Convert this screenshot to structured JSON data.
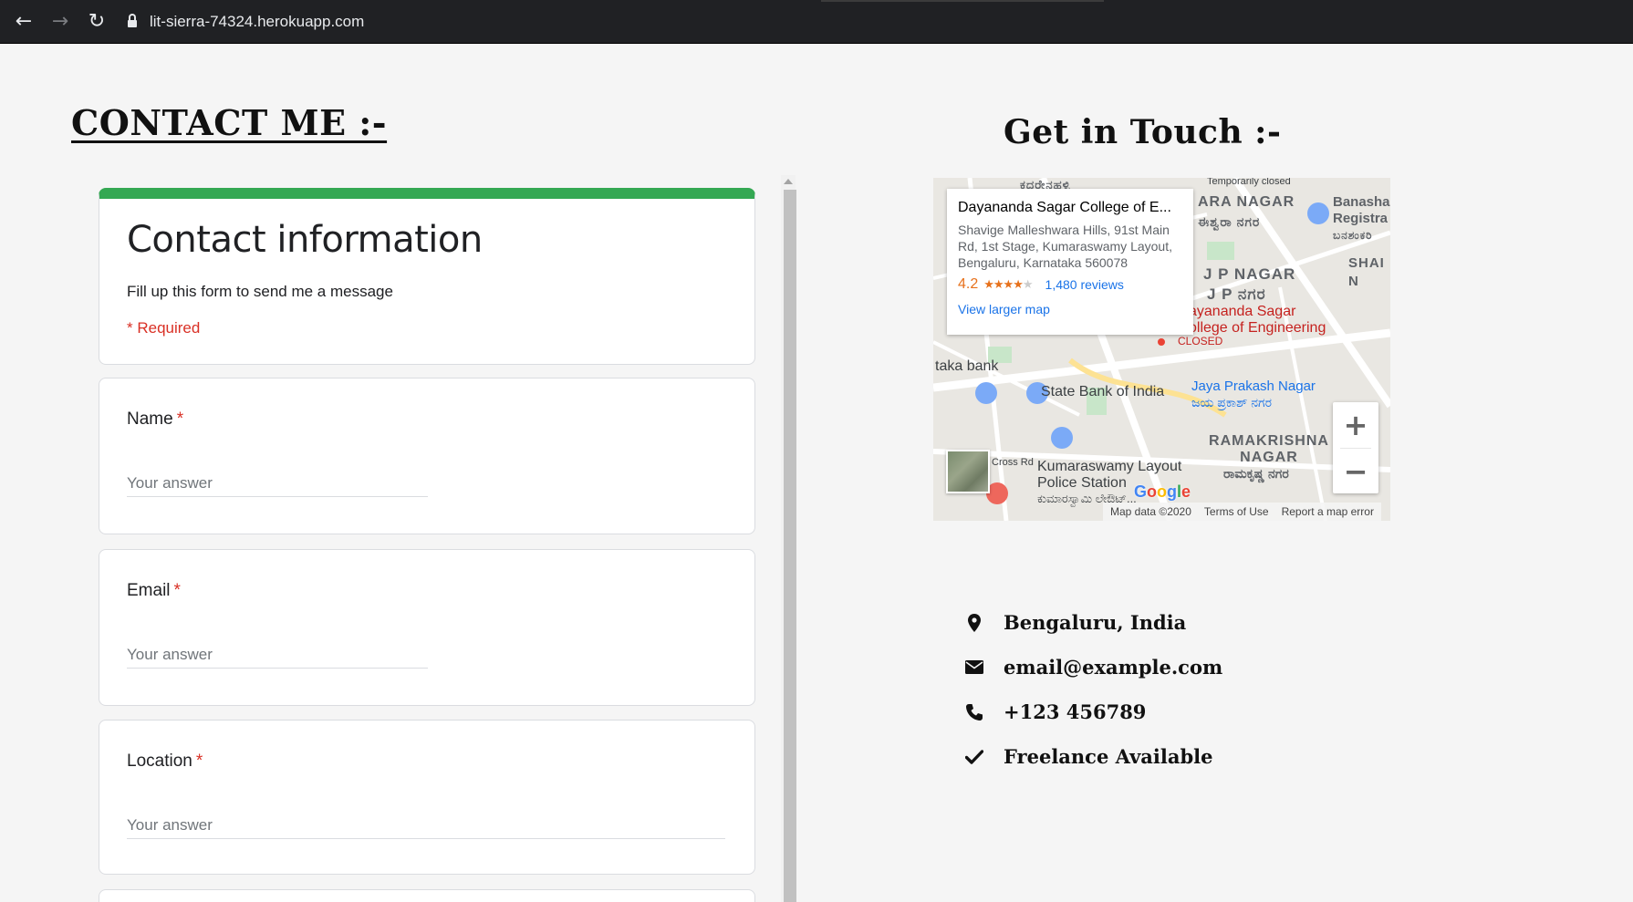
{
  "browser": {
    "url": "lit-sierra-74324.herokuapp.com",
    "back_icon": "arrow-left-icon",
    "forward_icon": "arrow-right-icon",
    "reload_icon": "reload-icon"
  },
  "page": {
    "contact_heading": "CONTACT ME :-",
    "touch_heading": "Get in Touch :-"
  },
  "form": {
    "title": "Contact information",
    "description": "Fill up this form to send me a message",
    "required_note": "* Required",
    "accent_color": "#34a853",
    "questions": [
      {
        "label": "Name",
        "placeholder": "Your answer"
      },
      {
        "label": "Email",
        "placeholder": "Your answer"
      },
      {
        "label": "Location",
        "placeholder": "Your answer"
      }
    ],
    "required_star": "*"
  },
  "map": {
    "place_name": "Dayananda Sagar College of E...",
    "address": "Shavige Malleshwara Hills, 91st Main Rd, 1st Stage, Kumaraswamy Layout, Bengaluru, Karnataka 560078",
    "rating": "4.2",
    "stars_filled": 4,
    "reviews": "1,480 reviews",
    "larger_map": "View larger map",
    "zoom_in": "+",
    "zoom_out": "−",
    "footer": {
      "map_data": "Map data ©2020",
      "terms": "Terms of Use",
      "report": "Report a map error"
    },
    "labels": {
      "top": "ಕದರೇನಹಳ್ಳಿ",
      "temp_closed": "Temporarily closed",
      "ara_nagar": "ARA NAGAR",
      "ara_nagar_kn": "ಈಶ್ವರಾ ನಗರ",
      "banashankari": "Banasha Registra",
      "banashankari_kn": "ಬನಶಂಕರಿ",
      "jp_nagar": "J P NAGAR",
      "jp_nagar_kn": "J P ನಗರ",
      "shak": "SHAI N",
      "dsce": "ayananda Sagar\nollege of Engineering",
      "closed": "CLOSED",
      "taka_bank": "taka bank",
      "sbi": "State Bank of India",
      "jaya_prakash": "Jaya Prakash Nagar",
      "jaya_prakash_kn": "ಜಯ ಪ್ರಕಾಶ್ ನಗರ",
      "ramakrishna": "RAMAKRISHNA NAGAR",
      "ramakrishna_kn": "ರಾಮಕೃಷ್ಣ ನಗರ",
      "kumaraswamy": "Kumaraswamy Layout Police Station",
      "kumaraswamy_kn": "ಕುಮಾರಸ್ವಾಮಿ ಲೇಔಟ್...",
      "cross_rd": "Cross Rd",
      "google": "Google"
    }
  },
  "contact_info": [
    {
      "icon": "map-pin-icon",
      "text": "Bengaluru, India"
    },
    {
      "icon": "envelope-icon",
      "text": "email@example.com"
    },
    {
      "icon": "phone-icon",
      "text": "+123 456789"
    },
    {
      "icon": "checkmark-icon",
      "text": "Freelance Available"
    }
  ]
}
